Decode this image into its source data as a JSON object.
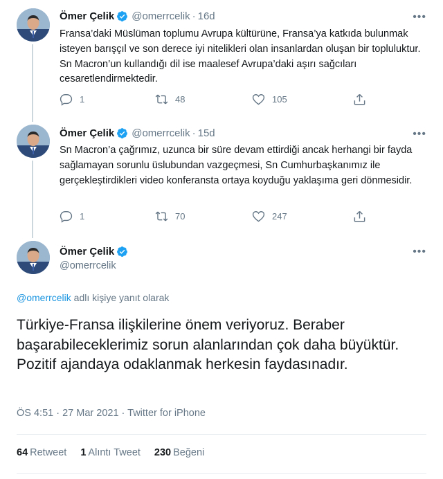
{
  "colors": {
    "accent": "#1b95e0",
    "muted": "#657786",
    "text": "#14171a",
    "divider": "#e6ecf0"
  },
  "tweets": [
    {
      "name": "Ömer Çelik",
      "handle": "@omerrcelik",
      "time": "16d",
      "text": "Fransa’daki Müslüman toplumu Avrupa kültürüne, Fransa’ya katkıda bulunmak isteyen barışçıl ve son derece iyi nitelikleri olan insanlardan oluşan bir topluluktur. Sn Macron’un kullandığı dil ise maalesef Avrupa’daki aşırı sağcıları cesaretlendirmektedir.",
      "replies": "1",
      "retweets": "48",
      "likes": "105"
    },
    {
      "name": "Ömer Çelik",
      "handle": "@omerrcelik",
      "time": "15d",
      "text": "Sn Macron’a çağrımız, uzunca bir süre devam ettirdiği ancak herhangi bir fayda sağlamayan sorunlu üslubundan vazgeçmesi, Sn Cumhurbaşkanımız ile gerçekleştirdikleri video konferansta ortaya koyduğu yaklaşıma geri dönmesidir.",
      "replies": "1",
      "retweets": "70",
      "likes": "247"
    }
  ],
  "main": {
    "name": "Ömer Çelik",
    "handle": "@omerrcelik",
    "reply_to_handle": "@omerrcelik",
    "reply_to_suffix": " adlı kişiye yanıt olarak",
    "text": "Türkiye-Fransa ilişkilerine önem veriyoruz. Beraber başarabileceklerimiz sorun alanlarından çok daha büyüktür. Pozitif ajandaya odaklanmak herkesin faydasınadır.",
    "time": "ÖS 4:51",
    "date": "27 Mar 2021",
    "source": "Twitter for iPhone",
    "retweet_count": "64",
    "retweet_label": "Retweet",
    "quote_count": "1",
    "quote_label": "Alıntı Tweet",
    "like_count": "230",
    "like_label": "Beğeni"
  },
  "icons": {
    "more": "more-icon",
    "reply": "reply-icon",
    "retweet": "retweet-icon",
    "like": "heart-icon",
    "share": "share-icon",
    "verified": "verified-badge-icon"
  }
}
